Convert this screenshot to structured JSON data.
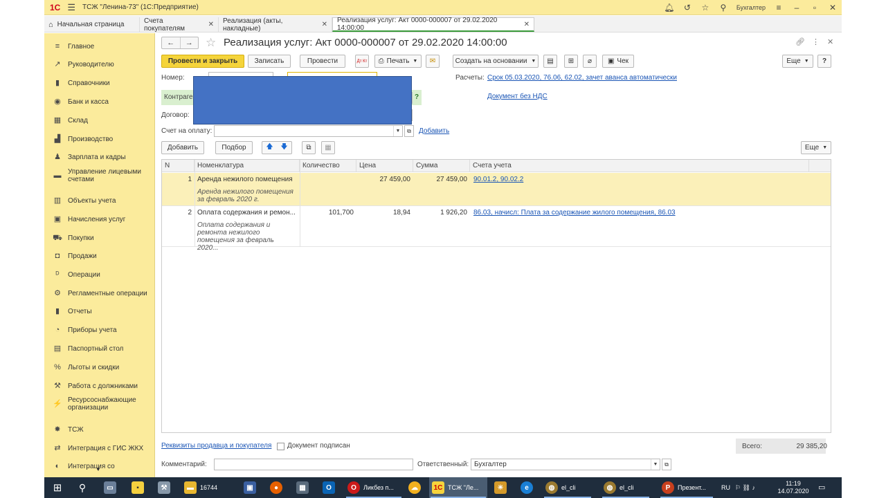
{
  "window": {
    "title": "ТСЖ \"Ленина-73\"  (1С:Предприятие)",
    "user": "Бухгалтер"
  },
  "tabs": [
    {
      "label": "Начальная страница"
    },
    {
      "label": "Счета покупателям"
    },
    {
      "label": "Реализация (акты, накладные)"
    },
    {
      "label": "Реализация услуг: Акт 0000-000007 от 29.02.2020 14:00:00"
    }
  ],
  "sidebar": {
    "items": [
      {
        "label": "Главное",
        "icon": "menu-icon"
      },
      {
        "label": "Руководителю",
        "icon": "trend-icon"
      },
      {
        "label": "Справочники",
        "icon": "book-icon"
      },
      {
        "label": "Банк и касса",
        "icon": "coin-icon"
      },
      {
        "label": "Склад",
        "icon": "warehouse-icon"
      },
      {
        "label": "Производство",
        "icon": "factory-icon"
      },
      {
        "label": "Зарплата и кадры",
        "icon": "person-icon"
      },
      {
        "label": "Управление лицевыми счетами",
        "icon": "accounts-icon"
      },
      {
        "label": "Объекты учета",
        "icon": "building-icon"
      },
      {
        "label": "Начисления услуг",
        "icon": "calculator-icon"
      },
      {
        "label": "Покупки",
        "icon": "cart-icon"
      },
      {
        "label": "Продажи",
        "icon": "bag-icon"
      },
      {
        "label": "Операции",
        "icon": "dtkt-icon"
      },
      {
        "label": "Регламентные операции",
        "icon": "gears-icon"
      },
      {
        "label": "Отчеты",
        "icon": "chart-icon"
      },
      {
        "label": "Приборы учета",
        "icon": "gauge-icon"
      },
      {
        "label": "Паспортный стол",
        "icon": "passport-icon"
      },
      {
        "label": "Льготы и скидки",
        "icon": "percent-icon"
      },
      {
        "label": "Работа с должниками",
        "icon": "gavel-icon"
      },
      {
        "label": "Ресурсоснабжающие организации",
        "icon": "resource-icon"
      },
      {
        "label": "ТСЖ",
        "icon": "tszh-icon"
      },
      {
        "label": "Интеграция с ГИС ЖКХ",
        "icon": "integration-icon"
      },
      {
        "label": "Интеграция со",
        "icon": "integration2-icon"
      }
    ]
  },
  "doc": {
    "title": "Реализация услуг: Акт 0000-000007 от 29.02.2020 14:00:00"
  },
  "toolbar": {
    "post_close": "Провести и закрыть",
    "save": "Записать",
    "post": "Провести",
    "print": "Печать",
    "create_based": "Создать на основании",
    "check": "Чек",
    "more": "Еще",
    "help": "?",
    "dtkt": "Дт Кт"
  },
  "form": {
    "number_label": "Номер:",
    "counterparty_label": "Контрагент:",
    "contract_label": "Договор:",
    "invoice_label": "Счет на оплату:",
    "invoice_add": "Добавить",
    "settlements_label": "Расчеты:",
    "settlements_link": "Срок 05.03.2020, 76.06, 62.02, зачет аванса автоматически",
    "vat_link": "Документ без НДС",
    "q": "?"
  },
  "table_toolbar": {
    "add": "Добавить",
    "pick": "Подбор",
    "more": "Еще"
  },
  "table": {
    "headers": [
      "N",
      "Номенклатура",
      "Количество",
      "Цена",
      "Сумма",
      "Счета учета"
    ],
    "rows": [
      {
        "n": "1",
        "name": "Аренда нежилого помещения",
        "desc": "Аренда нежилого помещения за февраль 2020 г.",
        "qty": "",
        "price": "27 459,00",
        "sum": "27 459,00",
        "accounts": "90.01.2, 90.02.2"
      },
      {
        "n": "2",
        "name": "Оплата содержания и ремон...",
        "desc": "Оплата содержания и ремонта нежилого помещения за февраль 2020...",
        "qty": "101,700",
        "price": "18,94",
        "sum": "1 926,20",
        "accounts": "86.03, начисл: Плата за содержание жилого помещения, 86.03"
      }
    ]
  },
  "footer": {
    "seller_link": "Реквизиты продавца и покупателя",
    "signed": "Документ подписан",
    "total_label": "Всего:",
    "total": "29 385,20",
    "comment_label": "Комментарий:",
    "responsible_label": "Ответственный:",
    "responsible": "Бухгалтер"
  },
  "taskbar": {
    "items": [
      {
        "label": "16744"
      },
      {
        "label": "Ликбез п..."
      },
      {
        "label": "ТСЖ \"Ле..."
      },
      {
        "label": "el_cli"
      },
      {
        "label": "el_cli"
      },
      {
        "label": "Презент..."
      }
    ],
    "lang": "RU",
    "time": "11:19",
    "date": "14.07.2020",
    "notif": "1"
  }
}
